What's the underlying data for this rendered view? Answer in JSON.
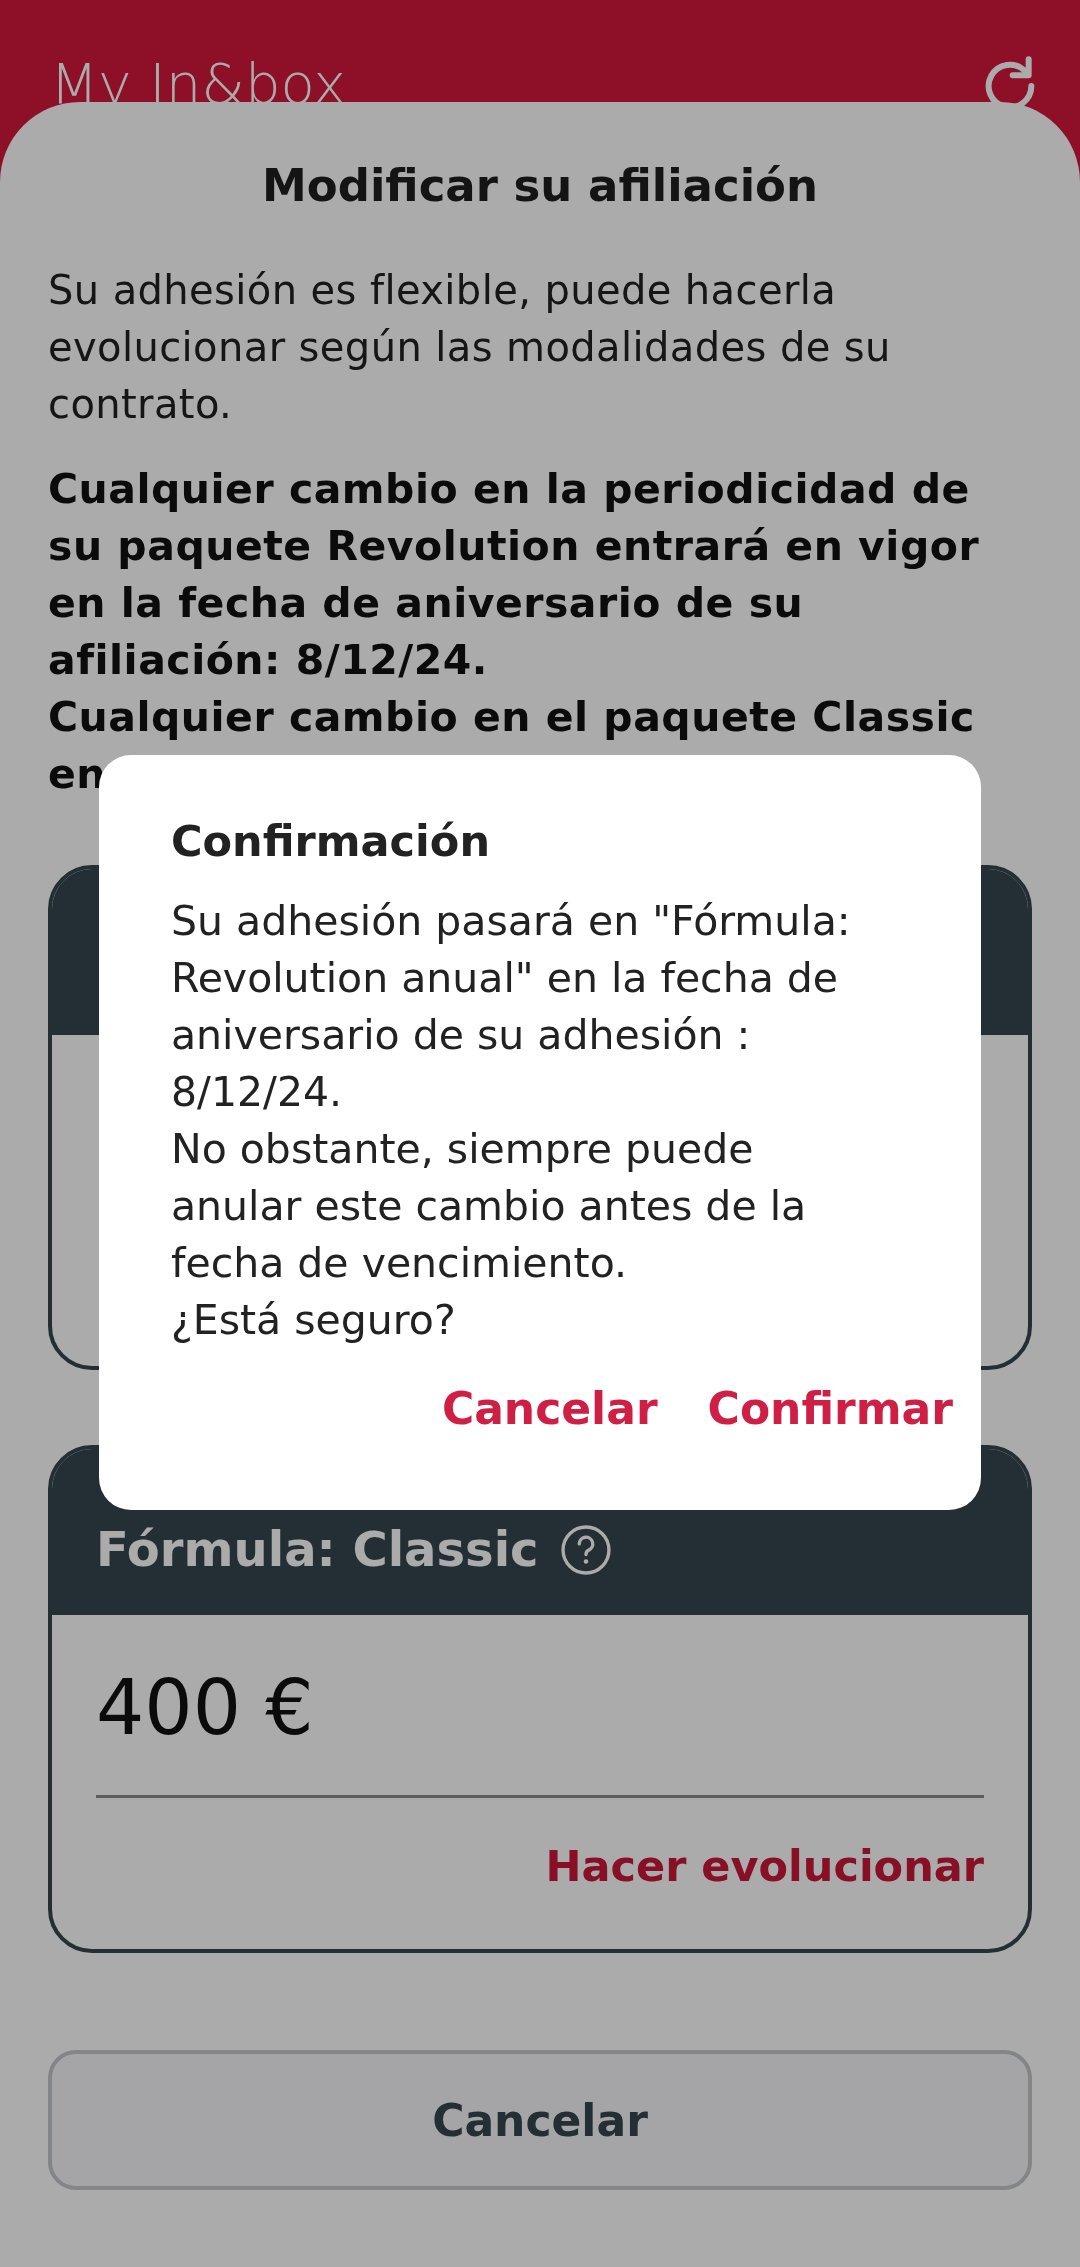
{
  "app_bar": {
    "title": "My In&box"
  },
  "sheet": {
    "title": "Modificar su afiliación",
    "intro": "Su adhesión es flexible, puede hacerla evolucionar según las modalidades de su contrato.",
    "notice": [
      "Cualquier cambio en la periodicidad de su paquete Revolution entrará en vigor en la fecha de aniversario de su afiliación: 8/12/24.",
      "Cualquier cambio en el paquete Classic en"
    ],
    "plans": [
      {
        "covered": true
      },
      {
        "covered": false,
        "title": "Fórmula: Classic",
        "price": "400 €",
        "action": "Hacer evolucionar"
      }
    ],
    "cancel_button": "Cancelar"
  },
  "dialog": {
    "title": "Confirmación",
    "body": [
      "Su adhesión pasará en \"Fórmula: Revolution anual\" en la fecha de aniversario de su adhesión : 8/12/24.",
      "No obstante, siempre puede anular este cambio antes de la fecha de vencimiento.",
      "¿Está seguro?"
    ],
    "buttons": [
      "Cancelar",
      "Confirmar"
    ]
  }
}
